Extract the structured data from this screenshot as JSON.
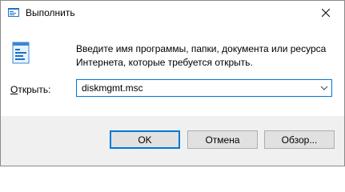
{
  "window": {
    "title": "Выполнить",
    "close_icon": "close-icon",
    "app_icon": "run-icon"
  },
  "main": {
    "description": "Введите имя программы, папки, документа или ресурса Интернета, которые требуется открыть.",
    "open_label_prefix": "О",
    "open_label_rest": "ткрыть:",
    "input_value": "diskmgmt.msc",
    "dropdown_icon": "chevron-down-icon"
  },
  "buttons": {
    "ok": "OK",
    "cancel": "Отмена",
    "browse": "Обзор..."
  },
  "colors": {
    "accent": "#0078d7",
    "footer_bg": "#f0f0f0",
    "button_bg": "#e1e1e1"
  }
}
